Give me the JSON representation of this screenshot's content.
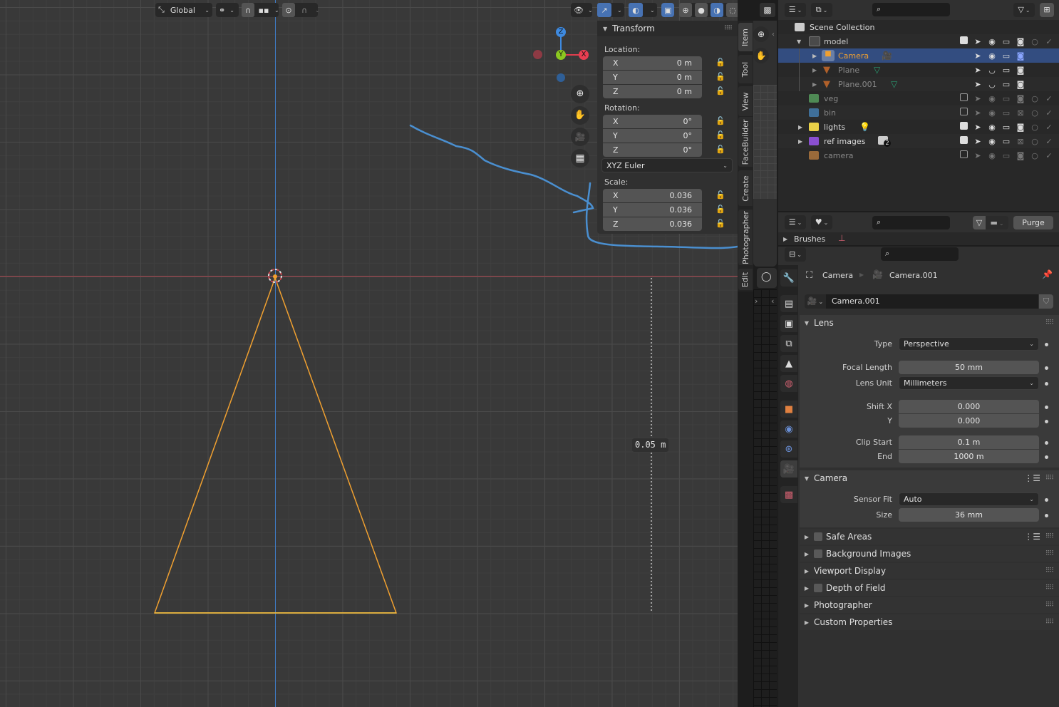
{
  "viewport": {
    "header": {
      "orientation": "Global",
      "orientation_icon": "transform-orientation-icon",
      "pivot_icon": "pivot-link-icon",
      "snap_icon": "magnet-icon",
      "snap_target_icon": "snap-grid-icon",
      "proportional_icon": "proportional-edit-icon",
      "falloff_icon": "falloff-curve-icon",
      "visibility_icon": "object-visibility-icon",
      "gizmo_icon": "gizmo-icon",
      "overlay_icon": "overlay-icon",
      "xray_icon": "xray-icon",
      "shading_modes": [
        "wireframe",
        "solid",
        "material-preview",
        "rendered"
      ],
      "active_shading": "material-preview"
    },
    "navigation_gizmo": {
      "z": "Z",
      "y": "Y",
      "x": "X"
    },
    "nav_buttons": [
      "zoom",
      "pan",
      "camera-view",
      "ortho-grid"
    ],
    "measure_label": "0.05 m",
    "colors": {
      "x_axis": "#c8424b",
      "y_axis": "#3e7ac4",
      "selected": "#f0a030",
      "annotation": "#4a8fd0"
    }
  },
  "transform_panel": {
    "title": "Transform",
    "location_label": "Location:",
    "location": [
      {
        "axis": "X",
        "value": "0 m"
      },
      {
        "axis": "Y",
        "value": "0 m"
      },
      {
        "axis": "Z",
        "value": "0 m"
      }
    ],
    "rotation_label": "Rotation:",
    "rotation": [
      {
        "axis": "X",
        "value": "0°"
      },
      {
        "axis": "Y",
        "value": "0°"
      },
      {
        "axis": "Z",
        "value": "0°"
      }
    ],
    "rotation_mode": "XYZ Euler",
    "scale_label": "Scale:",
    "scale": [
      {
        "axis": "X",
        "value": "0.036"
      },
      {
        "axis": "Y",
        "value": "0.036"
      },
      {
        "axis": "Z",
        "value": "0.036"
      }
    ]
  },
  "sidebar_tabs": [
    "Item",
    "Tool",
    "View",
    "FaceBuilder",
    "Create",
    "Photographer",
    "Edit"
  ],
  "outliner": {
    "root": "Scene Collection",
    "rows": [
      {
        "name": "model",
        "type": "collection",
        "color": "#d0d0d0",
        "checked": true,
        "expanded": true
      },
      {
        "name": "Camera",
        "type": "camera",
        "color": "#f0a030",
        "selected": true
      },
      {
        "name": "Plane",
        "type": "mesh",
        "color": "#888888"
      },
      {
        "name": "Plane.001",
        "type": "mesh",
        "color": "#888888"
      },
      {
        "name": "veg",
        "type": "collection",
        "color": "#888888",
        "collection_color": "#4f8a55",
        "checked": false
      },
      {
        "name": "bin",
        "type": "collection",
        "color": "#888888",
        "collection_color": "#3f6f99",
        "checked": false
      },
      {
        "name": "lights",
        "type": "collection",
        "color": "#d0d0d0",
        "collection_color": "#e8d048",
        "checked": true
      },
      {
        "name": "ref images",
        "type": "collection",
        "color": "#d0d0d0",
        "collection_color": "#8a4fd0",
        "checked": true,
        "badge": "2"
      },
      {
        "name": "camera",
        "type": "collection",
        "color": "#888888",
        "collection_color": "#9a6a3a",
        "checked": false
      }
    ]
  },
  "orphan_data": {
    "purge_label": "Purge",
    "brushes_label": "Brushes"
  },
  "properties": {
    "breadcrumb": [
      "Camera",
      "Camera.001"
    ],
    "datablock_name": "Camera.001",
    "lens": {
      "title": "Lens",
      "type_label": "Type",
      "type_value": "Perspective",
      "focal_label": "Focal Length",
      "focal_value": "50 mm",
      "lens_unit_label": "Lens Unit",
      "lens_unit_value": "Millimeters",
      "shift_x_label": "Shift X",
      "shift_x_value": "0.000",
      "shift_y_label": "Y",
      "shift_y_value": "0.000",
      "clip_start_label": "Clip Start",
      "clip_start_value": "0.1 m",
      "clip_end_label": "End",
      "clip_end_value": "1000 m"
    },
    "camera": {
      "title": "Camera",
      "sensor_fit_label": "Sensor Fit",
      "sensor_fit_value": "Auto",
      "size_label": "Size",
      "size_value": "36 mm"
    },
    "collapsed_sections": [
      {
        "title": "Safe Areas",
        "checkbox": true
      },
      {
        "title": "Background Images",
        "checkbox": true
      },
      {
        "title": "Viewport Display",
        "checkbox": false
      },
      {
        "title": "Depth of Field",
        "checkbox": true
      },
      {
        "title": "Photographer",
        "checkbox": false
      },
      {
        "title": "Custom Properties",
        "checkbox": false
      }
    ]
  }
}
